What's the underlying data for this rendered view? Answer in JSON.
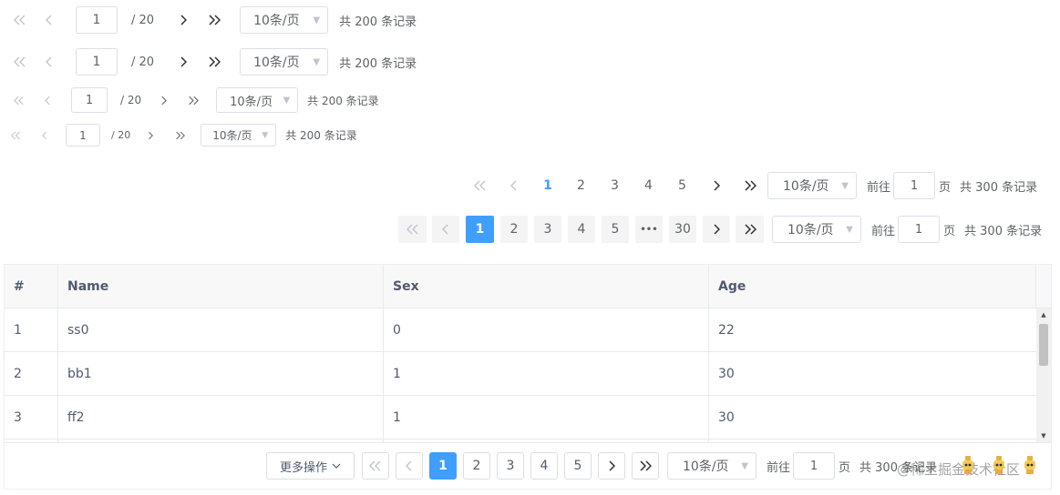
{
  "pager_simple": {
    "first_icon": "double-chevron-left-icon",
    "prev_icon": "chevron-left-icon",
    "next_icon": "chevron-right-icon",
    "last_icon": "double-chevron-right-icon",
    "current_page": "1",
    "total_pages_text": "/ 20",
    "page_size": "10条/页",
    "total_text": "共 200 条记录"
  },
  "pager_numbered": {
    "pages": [
      "1",
      "2",
      "3",
      "4",
      "5"
    ],
    "active_page": "1",
    "page_size": "10条/页",
    "goto_prefix": "前往",
    "goto_value": "1",
    "goto_suffix": "页",
    "total_text": "共 300 条记录"
  },
  "pager_background": {
    "pages": [
      "1",
      "2",
      "3",
      "4",
      "5"
    ],
    "ellipsis": "•••",
    "last_page": "30",
    "active_page": "1",
    "page_size": "10条/页",
    "goto_prefix": "前往",
    "goto_value": "1",
    "goto_suffix": "页",
    "total_text": "共 300 条记录"
  },
  "table": {
    "columns": [
      "#",
      "Name",
      "Sex",
      "Age"
    ],
    "rows": [
      [
        "1",
        "ss0",
        "0",
        "22"
      ],
      [
        "2",
        "bb1",
        "1",
        "30"
      ],
      [
        "3",
        "ff2",
        "1",
        "30"
      ]
    ]
  },
  "table_footer": {
    "more_button": "更多操作",
    "pages": [
      "1",
      "2",
      "3",
      "4",
      "5"
    ],
    "active_page": "1",
    "page_size": "10条/页",
    "goto_prefix": "前往",
    "goto_value": "1",
    "goto_suffix": "页",
    "total_text": "共 300 条记录"
  },
  "watermark": {
    "text": "@稀土掘金技术社区"
  },
  "colors": {
    "accent": "#409eff",
    "text": "#606266",
    "disabled": "#c0c4cc",
    "border": "#dcdfe6",
    "header_bg": "#f8f8f9"
  }
}
